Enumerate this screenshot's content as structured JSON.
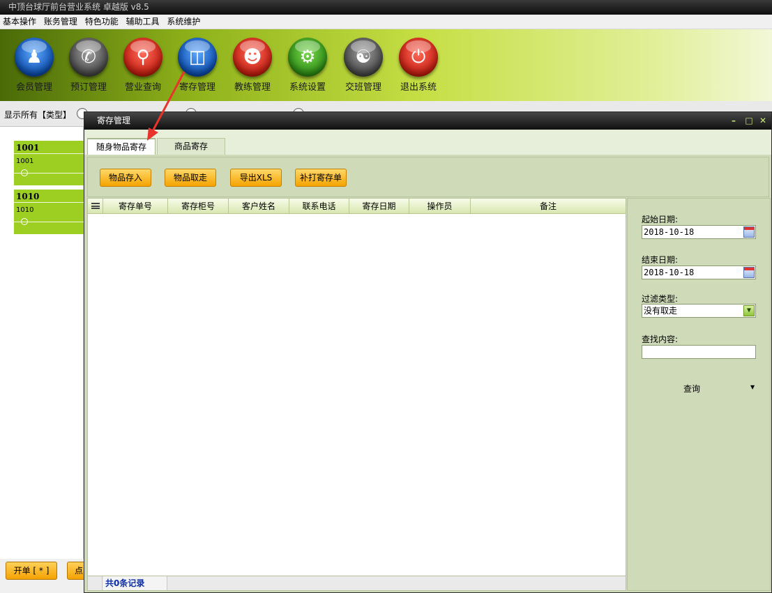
{
  "app": {
    "title": "中顶台球厅前台营业系统 卓越版 v8.5"
  },
  "menu": [
    "基本操作",
    "账务管理",
    "特色功能",
    "辅助工具",
    "系统维护"
  ],
  "toolbar": {
    "items": [
      {
        "label": "会员管理",
        "icon": "member-icon",
        "color": "#0c4dae"
      },
      {
        "label": "预订管理",
        "icon": "phone-icon",
        "color": "#454545"
      },
      {
        "label": "营业查询",
        "icon": "magnifier-icon",
        "color": "#c41d10"
      },
      {
        "label": "寄存管理",
        "icon": "bag-icon",
        "color": "#0c4dae"
      },
      {
        "label": "教练管理",
        "icon": "coach-icon",
        "color": "#c41d10"
      },
      {
        "label": "系统设置",
        "icon": "gear-icon",
        "color": "#2d8c14"
      },
      {
        "label": "交班管理",
        "icon": "meeting-icon",
        "color": "#454545"
      },
      {
        "label": "退出系统",
        "icon": "power-icon",
        "color": "#c41d10"
      }
    ]
  },
  "filter": {
    "show_all": "显示所有【类型】"
  },
  "rooms": [
    {
      "code": "1001",
      "sub": "1001"
    },
    {
      "code": "1010",
      "sub": "1010"
    }
  ],
  "bottom": {
    "open_label": "开单 [ * ]",
    "second_label": "点"
  },
  "modal": {
    "title": "寄存管理",
    "tabs": [
      "随身物品寄存",
      "商品寄存"
    ],
    "buttons": [
      "物品存入",
      "物品取走",
      "导出XLS",
      "补打寄存单"
    ],
    "columns": [
      "寄存单号",
      "寄存柜号",
      "客户姓名",
      "联系电话",
      "寄存日期",
      "操作员",
      "备注"
    ],
    "record_count": "共0条记录",
    "filters": {
      "start_label": "起始日期:",
      "start_value": "2018-10-18",
      "end_label": "结束日期:",
      "end_value": "2018-10-18",
      "type_label": "过滤类型:",
      "type_value": "没有取走",
      "search_label": "查找内容:",
      "search_value": "",
      "query_label": "查询"
    }
  },
  "colors": {
    "accent": "#f5a200",
    "toolbar_green": "#9ccf21",
    "annotation": "#e8342b"
  }
}
